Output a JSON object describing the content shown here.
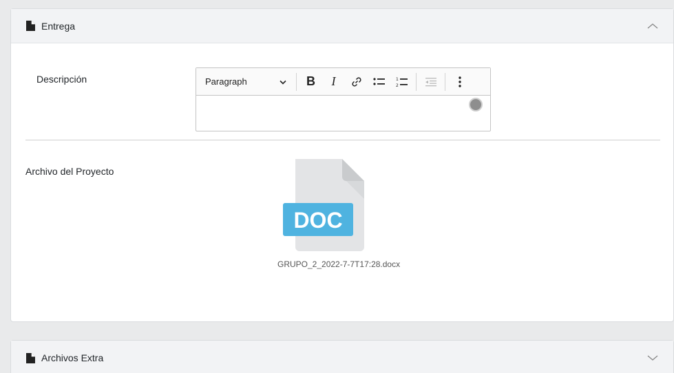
{
  "entrega": {
    "title": "Entrega",
    "descripcion_label": "Descripción",
    "editor": {
      "paragraph_label": "Paragraph",
      "content": ""
    },
    "archivo_label": "Archivo del Proyecto",
    "file": {
      "type_label": "DOC",
      "name": "GRUPO_2_2022-7-7T17:28.docx",
      "badge_color": "#4fb3e0",
      "page_color": "#e3e4e6"
    }
  },
  "archivos_extra": {
    "title": "Archivos Extra"
  },
  "icons": {
    "section": "file-icon",
    "collapse": "chevron-up-icon",
    "expand": "chevron-down-icon"
  }
}
